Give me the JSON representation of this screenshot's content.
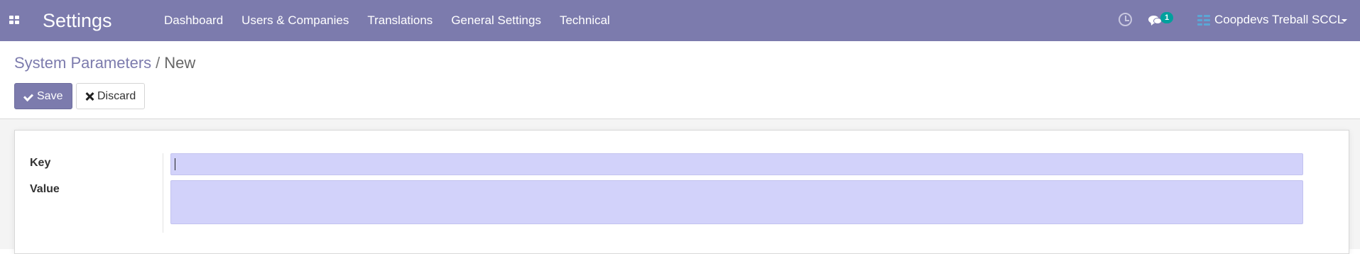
{
  "navbar": {
    "app_title": "Settings",
    "menu": [
      {
        "label": "Dashboard"
      },
      {
        "label": "Users & Companies"
      },
      {
        "label": "Translations"
      },
      {
        "label": "General Settings"
      },
      {
        "label": "Technical"
      }
    ],
    "activity_icon": "clock-icon",
    "messages_icon": "chat-icon",
    "messages_badge": "1",
    "company_icon": "company-switcher-icon",
    "company_name": "Coopdevs Treball SCCL"
  },
  "breadcrumb": {
    "parent": "System Parameters",
    "separator": "/",
    "current": "New"
  },
  "buttons": {
    "save_label": "Save",
    "discard_label": "Discard"
  },
  "form": {
    "key_label": "Key",
    "key_value": "",
    "value_label": "Value",
    "value_value": ""
  },
  "colors": {
    "brand": "#7c7bad",
    "input_required": "#d2d2fa",
    "badge": "#00a09d"
  }
}
